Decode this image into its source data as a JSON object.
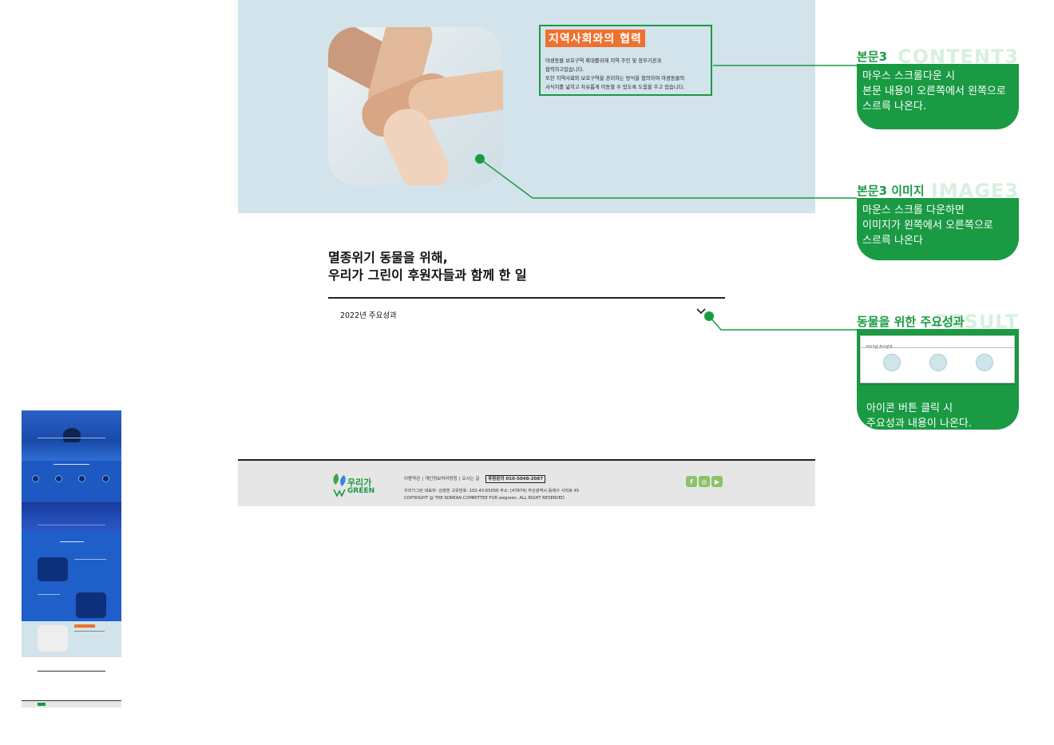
{
  "section3": {
    "title": "지역사회와의 협력",
    "body": "야생동물 보호구역 확대를위해 지역 주민 및 정부기관과\n협력하고있습니다.\n또한 지역사회와 보호구역을 관리하는 방식을 협의하여 야생동물의\n서식지를 넓히고 자유롭게 이동할 수 있도록 도움을 주고 있습니다."
  },
  "achievements": {
    "headline": "멸종위기 동물을 위해,\n우리가 그린이 후원자들과 함께 한 일",
    "accordion_label": "2022년 주요성과"
  },
  "footer": {
    "logo_ko": "우리가",
    "logo_en": "GREEN",
    "links": [
      "이용약관",
      "개인정보처리방침",
      "오시는 길"
    ],
    "hotline": "후원문의 010-5048-2087",
    "info": "우리가그린 대표자: 김영훈 고유번호: 102-43-65056 주소: [47874] 부산광역시 동래구 사직로 45\nCOPYRIGHT @ THE KOREAN COMMITTEE FOR wegreen. ALL RIGHT RESERVED",
    "social": [
      "f",
      "◎",
      "▶"
    ]
  },
  "callouts": [
    {
      "title": "본문3",
      "ghost": "CONTENT3",
      "text": "마우스 스크롤다운 시\n본문 내용이 오른쪽에서 왼쪽으로\n스르륵 나온다."
    },
    {
      "title": "본문3 이미지",
      "ghost": "IMAGE3",
      "text": "마운스 스크롤 다운하면\n이미지가 왼쪽에서 오른쪽으로\n스르륵 나온다"
    },
    {
      "title": "동물을 위한 주요성과",
      "ghost": "RESULT",
      "text": "아이콘 버튼 클릭 시\n주요성과 내용이 나온다.",
      "mini_label": "2022년 주요성과"
    }
  ],
  "colors": {
    "green": "#1a9a43",
    "orange": "#f07030",
    "section_bg": "#d3e3eb",
    "footer_bg": "#e6e6e6"
  }
}
